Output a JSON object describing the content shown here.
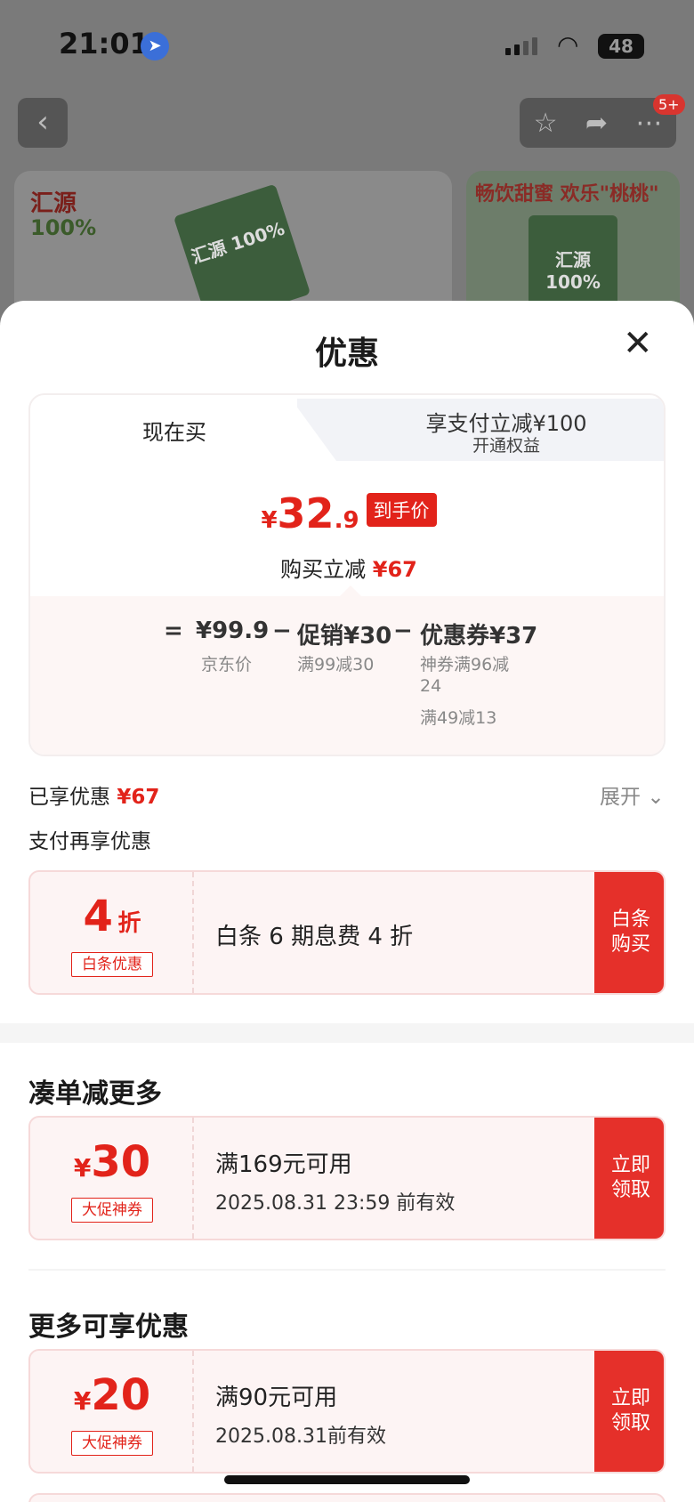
{
  "status_bar": {
    "time": "21:01",
    "battery": "48"
  },
  "background": {
    "badge": "5+",
    "banner1": {
      "logo": "汇源",
      "percent": "100%",
      "box_label": "汇源 100%"
    },
    "banner2": {
      "slogan": "畅饮甜蜜 欢乐\"桃桃\"",
      "box_label": "汇源 100%"
    }
  },
  "sheet": {
    "title": "优惠"
  },
  "tabs": {
    "now": "现在买",
    "pay_title": "享支付立减¥100",
    "pay_sub": "开通权益"
  },
  "price": {
    "yen": "¥",
    "integer": "32",
    "decimal": ".9",
    "tag": "到手价",
    "cut_label": "购买立减",
    "cut_value": "¥67"
  },
  "formula": {
    "equals": "=",
    "jd_price": "¥99.9",
    "jd_label": "京东价",
    "minus1": "−",
    "promo": "促销¥30",
    "promo_sub": "满99减30",
    "minus2": "−",
    "coupon": "优惠券¥37",
    "coupon_sub1": "神券满96减",
    "coupon_sub2": "24",
    "coupon_sub3": "满49减13"
  },
  "enjoyed": {
    "label": "已享优惠",
    "value": "¥67",
    "expand": "展开"
  },
  "pay_more": "支付再享优惠",
  "baitiao": {
    "amount": "4",
    "unit": "折",
    "tag": "白条优惠",
    "desc": "白条 6 期息费 4 折",
    "button": "白条\n购买"
  },
  "section1": {
    "title": "凑单减更多"
  },
  "coupon1": {
    "yen": "¥",
    "amount": "30",
    "tag": "大促神券",
    "condition": "满169元可用",
    "expiry": "2025.08.31 23:59 前有效",
    "button": "立即\n领取"
  },
  "section2": {
    "title": "更多可享优惠"
  },
  "coupon2": {
    "yen": "¥",
    "amount": "20",
    "tag": "大促神券",
    "condition": "满90元可用",
    "expiry": "2025.08.31前有效",
    "button": "立即\n领取"
  },
  "colors": {
    "accent": "#e2231a",
    "button": "#e5302a",
    "card_bg": "#fdf4f4"
  }
}
